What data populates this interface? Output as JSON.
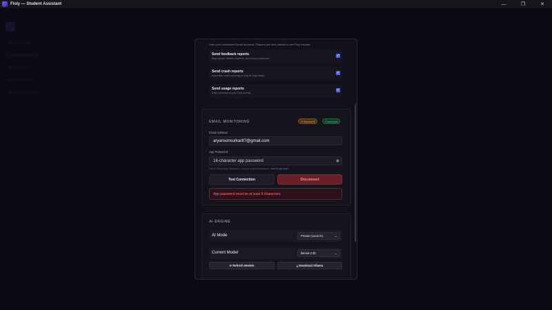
{
  "window": {
    "title": "Floiy — Student Assistant",
    "controls": [
      "—",
      "❐",
      "✕"
    ]
  },
  "modal": {
    "intro": "Data your connected Gmail accounts. Reports are sent directly to the Floiy founder.",
    "toggles": [
      {
        "title": "Send feedback reports",
        "sub": "Bug reports, feature requests, and survey responses",
        "checked": true
      },
      {
        "title": "Send crash reports",
        "sub": "Automatic crash reporting to help fix bugs faster",
        "checked": true
      },
      {
        "title": "Send usage reports",
        "sub": "Daily summary of your Floiy activity",
        "checked": true
      }
    ],
    "email": {
      "section_title": "EMAIL MONITORING",
      "badge_review": "⊙ Review B",
      "badge_connected": "Connected",
      "address_label": "Email Address",
      "address_value": "aryansonsurkar87@gmail.com",
      "password_label": "App Password",
      "password_placeholder": "16-character app password",
      "hint_text": "Use a Gmail App Password, not your regular password.",
      "hint_link": "How to get one?",
      "test_button": "Test Connection",
      "disconnect_button": "Disconnect",
      "error": "App password must be at least 8 characters."
    },
    "ai": {
      "section_title": "AI ENGINE",
      "mode_label": "AI Mode",
      "mode_value": "Private (Local AI)",
      "model_label": "Current Model",
      "model_value": "llama3.2:3b",
      "refresh_button": "⟳ Refresh Models",
      "download_button": "⤓ Download Ollama"
    }
  },
  "colors": {
    "accent": "#4b6cf0",
    "danger": "#ff6f7a",
    "success": "#4bd68a",
    "warning": "#f0b24a"
  }
}
